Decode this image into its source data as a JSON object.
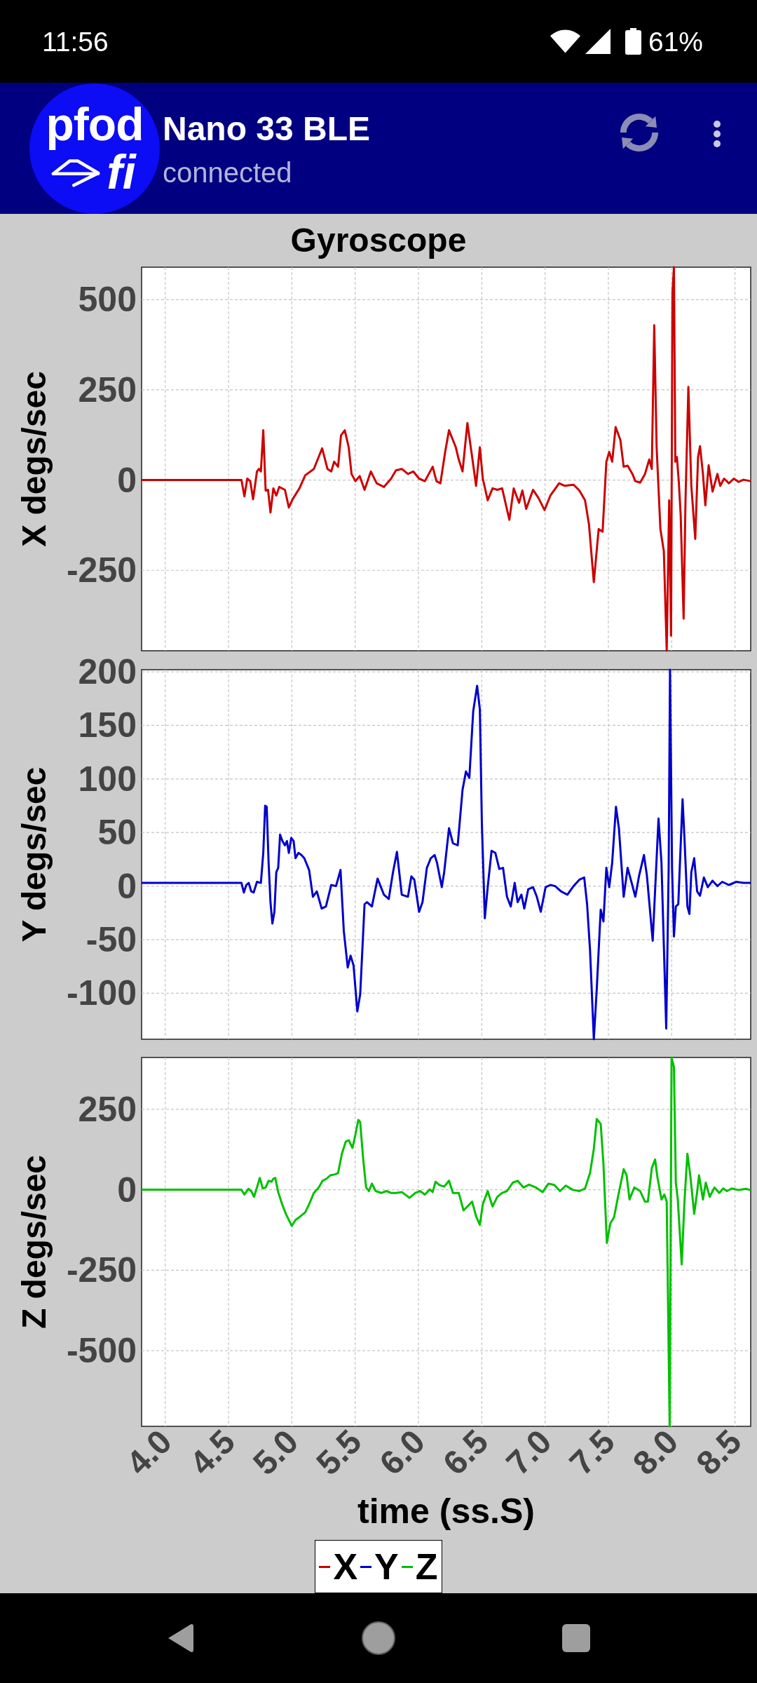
{
  "status_bar": {
    "time": "11:56",
    "battery": "61%"
  },
  "app_bar": {
    "logo": {
      "top_text": "pfod",
      "bottom_text": "fi"
    },
    "title": "Nano 33 BLE",
    "subtitle": "connected"
  },
  "plot": {
    "title": "Gyroscope",
    "panels": [
      {
        "chart_data": {
          "type": "line",
          "ylabel": "X degs/sec",
          "x": [
            3.813,
            4.602,
            4.625,
            4.648,
            4.671,
            4.694,
            4.724,
            4.74,
            4.755,
            4.774,
            4.793,
            4.812,
            4.831,
            4.854,
            4.877,
            4.9,
            4.945,
            4.976,
            5.006,
            5.06,
            5.105,
            5.174,
            5.239,
            5.281,
            5.311,
            5.334,
            5.365,
            5.388,
            5.418,
            5.449,
            5.471,
            5.502,
            5.536,
            5.574,
            5.624,
            5.67,
            5.727,
            5.784,
            5.822,
            5.868,
            5.917,
            5.959,
            6.005,
            6.051,
            6.112,
            6.142,
            6.173,
            6.211,
            6.241,
            6.295,
            6.318,
            6.348,
            6.386,
            6.424,
            6.455,
            6.485,
            6.508,
            6.547,
            6.585,
            6.623,
            6.661,
            6.718,
            6.752,
            6.794,
            6.821,
            6.851,
            6.905,
            6.947,
            6.996,
            7.042,
            7.111,
            7.156,
            7.225,
            7.271,
            7.316,
            7.347,
            7.385,
            7.423,
            7.454,
            7.484,
            7.507,
            7.53,
            7.557,
            7.595,
            7.621,
            7.652,
            7.69,
            7.713,
            7.751,
            7.789,
            7.823,
            7.843,
            7.862,
            7.881,
            7.911,
            7.938,
            7.961,
            7.98,
            7.995,
            8.006,
            8.018,
            8.029,
            8.041,
            8.056,
            8.071,
            8.094,
            8.109,
            8.132,
            8.155,
            8.186,
            8.208,
            8.224,
            8.247,
            8.266,
            8.292,
            8.323,
            8.361,
            8.384,
            8.414,
            8.452,
            8.491,
            8.529,
            8.567,
            8.624
          ],
          "series": [
            {
              "name": "X",
              "color": "#cc0000",
              "values": [
                0,
                0,
                -45,
                4,
                -3,
                -53,
                24,
                31,
                24,
                138,
                -29,
                -27,
                -90,
                -23,
                -43,
                -19,
                -27,
                -76,
                -53,
                -23,
                13,
                31,
                88,
                31,
                24,
                51,
                37,
                124,
                138,
                91,
                17,
                -3,
                11,
                -27,
                24,
                -9,
                -19,
                4,
                27,
                31,
                17,
                24,
                4,
                -3,
                37,
                -3,
                -9,
                78,
                138,
                91,
                57,
                24,
                158,
                64,
                -16,
                91,
                4,
                -56,
                -23,
                -27,
                -23,
                -110,
                -23,
                -63,
                -29,
                -80,
                -27,
                -49,
                -83,
                -43,
                -9,
                -16,
                -13,
                -29,
                -56,
                -123,
                -283,
                -136,
                -143,
                51,
                78,
                51,
                147,
                111,
                37,
                40,
                17,
                -3,
                -7,
                17,
                57,
                31,
                429,
                91,
                -136,
                -197,
                -473,
                -56,
                -431,
                519,
                590,
                51,
                64,
                -3,
                -96,
                -384,
                -56,
                258,
                -16,
                -163,
                64,
                94,
                17,
                -70,
                41,
                -32,
                17,
                -16,
                4,
                -9,
                4,
                -5,
                1,
                -3
              ]
            }
          ],
          "xlim": [
            3.813,
            8.624
          ],
          "ylim": [
            -473,
            590
          ],
          "yticks": [
            -250,
            0,
            250,
            500
          ],
          "grid": true
        }
      },
      {
        "chart_data": {
          "type": "line",
          "ylabel": "Y degs/sec",
          "x": [
            3.813,
            4.602,
            4.621,
            4.64,
            4.659,
            4.679,
            4.698,
            4.724,
            4.755,
            4.774,
            4.789,
            4.801,
            4.816,
            4.831,
            4.846,
            4.862,
            4.877,
            4.892,
            4.907,
            4.926,
            4.945,
            4.961,
            4.976,
            4.995,
            5.014,
            5.029,
            5.052,
            5.075,
            5.098,
            5.136,
            5.166,
            5.197,
            5.235,
            5.269,
            5.311,
            5.349,
            5.384,
            5.41,
            5.441,
            5.464,
            5.487,
            5.517,
            5.54,
            5.574,
            5.593,
            5.632,
            5.677,
            5.727,
            5.765,
            5.799,
            5.83,
            5.868,
            5.917,
            5.944,
            5.967,
            6.005,
            6.032,
            6.066,
            6.097,
            6.127,
            6.146,
            6.184,
            6.203,
            6.241,
            6.272,
            6.31,
            6.348,
            6.375,
            6.402,
            6.432,
            6.463,
            6.485,
            6.501,
            6.524,
            6.547,
            6.577,
            6.607,
            6.638,
            6.668,
            6.699,
            6.729,
            6.76,
            6.783,
            6.813,
            6.836,
            6.867,
            6.905,
            6.935,
            6.966,
            7.004,
            7.042,
            7.08,
            7.126,
            7.176,
            7.225,
            7.271,
            7.309,
            7.332,
            7.355,
            7.385,
            7.408,
            7.439,
            7.461,
            7.484,
            7.507,
            7.53,
            7.56,
            7.583,
            7.621,
            7.652,
            7.682,
            7.713,
            7.743,
            7.781,
            7.804,
            7.85,
            7.896,
            7.919,
            7.957,
            7.976,
            7.987,
            8.003,
            8.018,
            8.033,
            8.052,
            8.071,
            8.086,
            8.101,
            8.124,
            8.14,
            8.155,
            8.178,
            8.201,
            8.224,
            8.254,
            8.285,
            8.323,
            8.361,
            8.399,
            8.452,
            8.51,
            8.567,
            8.624
          ],
          "series": [
            {
              "name": "Y",
              "color": "#0000cc",
              "values": [
                3,
                3,
                -6,
                1,
                3,
                -5,
                -6,
                4,
                3,
                31,
                75,
                74,
                22,
                -15,
                -35,
                -24,
                13,
                17,
                48,
                42,
                38,
                42,
                31,
                45,
                42,
                26,
                31,
                29,
                26,
                15,
                -10,
                -5,
                -21,
                -19,
                1,
                0,
                15,
                -42,
                -76,
                -65,
                -74,
                -117,
                -101,
                -17,
                -15,
                -19,
                7,
                -8,
                -12,
                13,
                32,
                -8,
                -10,
                9,
                6,
                -24,
                -15,
                17,
                26,
                29,
                22,
                -1,
                13,
                54,
                40,
                38,
                90,
                107,
                101,
                163,
                187,
                165,
                58,
                -30,
                -1,
                33,
                31,
                16,
                17,
                -10,
                -19,
                3,
                -15,
                -8,
                -21,
                -3,
                -1,
                -10,
                -24,
                -1,
                1,
                0,
                -5,
                -8,
                0,
                6,
                8,
                -17,
                -60,
                -143,
                -96,
                -22,
                -33,
                17,
                -1,
                22,
                74,
                54,
                -10,
                17,
                4,
                -10,
                10,
                29,
                10,
                -51,
                63,
                22,
                -133,
                17,
                202,
                17,
                -47,
                -19,
                -17,
                38,
                81,
                45,
                -19,
                -26,
                13,
                26,
                -5,
                -9,
                8,
                -1,
                5,
                0,
                4,
                1,
                4,
                3,
                3
              ]
            }
          ],
          "xlim": [
            3.813,
            8.624
          ],
          "ylim": [
            -143,
            202
          ],
          "yticks": [
            -100,
            -50,
            0,
            50,
            100,
            150,
            200
          ],
          "grid": true
        }
      },
      {
        "chart_data": {
          "type": "line",
          "xlabel": "time (ss.S)",
          "ylabel": "Z degs/sec",
          "x": [
            3.813,
            4.602,
            4.625,
            4.656,
            4.679,
            4.701,
            4.724,
            4.747,
            4.77,
            4.793,
            4.816,
            4.839,
            4.854,
            4.869,
            4.892,
            4.923,
            4.953,
            4.999,
            5.029,
            5.06,
            5.105,
            5.136,
            5.174,
            5.212,
            5.243,
            5.273,
            5.304,
            5.342,
            5.365,
            5.395,
            5.426,
            5.449,
            5.479,
            5.502,
            5.525,
            5.54,
            5.563,
            5.586,
            5.609,
            5.632,
            5.662,
            5.708,
            5.746,
            5.784,
            5.822,
            5.868,
            5.929,
            5.975,
            6.013,
            6.051,
            6.089,
            6.112,
            6.135,
            6.165,
            6.203,
            6.241,
            6.272,
            6.318,
            6.356,
            6.386,
            6.424,
            6.455,
            6.485,
            6.508,
            6.547,
            6.585,
            6.623,
            6.661,
            6.699,
            6.745,
            6.783,
            6.829,
            6.874,
            6.928,
            6.981,
            7.027,
            7.073,
            7.118,
            7.164,
            7.217,
            7.271,
            7.316,
            7.355,
            7.385,
            7.408,
            7.439,
            7.461,
            7.488,
            7.515,
            7.545,
            7.576,
            7.621,
            7.644,
            7.667,
            7.705,
            7.751,
            7.789,
            7.812,
            7.843,
            7.869,
            7.888,
            7.919,
            7.942,
            7.961,
            7.984,
            7.999,
            8.018,
            8.033,
            8.048,
            8.079,
            8.101,
            8.124,
            8.147,
            8.178,
            8.201,
            8.216,
            8.247,
            8.269,
            8.3,
            8.338,
            8.376,
            8.407,
            8.437,
            8.475,
            8.529,
            8.586,
            8.624
          ],
          "series": [
            {
              "name": "Z",
              "color": "#00c000",
              "values": [
                0,
                0,
                -15,
                3,
                -4,
                -22,
                7,
                37,
                4,
                7,
                28,
                25,
                34,
                37,
                -7,
                -45,
                -75,
                -112,
                -94,
                -85,
                -70,
                -45,
                -10,
                7,
                28,
                34,
                45,
                48,
                52,
                112,
                150,
                154,
                130,
                172,
                217,
                210,
                97,
                7,
                -4,
                19,
                -4,
                -10,
                -4,
                -10,
                -10,
                -7,
                -25,
                -10,
                -4,
                -15,
                1,
                -7,
                25,
                15,
                10,
                28,
                -10,
                -10,
                -64,
                -52,
                -37,
                -82,
                -109,
                -45,
                -4,
                -52,
                -22,
                -10,
                -4,
                22,
                28,
                7,
                16,
                7,
                -7,
                19,
                15,
                -4,
                13,
                0,
                -4,
                4,
                52,
                127,
                220,
                205,
                82,
                -165,
                -105,
                -85,
                -22,
                64,
                45,
                -30,
                7,
                -4,
                -37,
                -37,
                67,
                94,
                37,
                -30,
                -15,
                -37,
                -735,
                411,
                382,
                22,
                -30,
                -232,
                -37,
                112,
                45,
                -75,
                -7,
                45,
                -30,
                22,
                -22,
                7,
                -10,
                4,
                -4,
                4,
                -1,
                3,
                -1
              ]
            }
          ],
          "xlim": [
            3.813,
            8.624
          ],
          "ylim": [
            -735,
            411
          ],
          "xticks": [
            {
              "value": 4,
              "label": "4.0"
            },
            {
              "value": 4.5,
              "label": "4.5"
            },
            {
              "value": 5,
              "label": "5.0"
            },
            {
              "value": 5.5,
              "label": "5.5"
            },
            {
              "value": 6,
              "label": "6.0"
            },
            {
              "value": 6.5,
              "label": "6.5"
            },
            {
              "value": 7,
              "label": "7.0"
            },
            {
              "value": 7.5,
              "label": "7.5"
            },
            {
              "value": 8,
              "label": "8.0"
            },
            {
              "value": 8.5,
              "label": "8.5"
            }
          ],
          "yticks": [
            -500,
            -250,
            0,
            250
          ],
          "grid": true
        }
      }
    ]
  }
}
